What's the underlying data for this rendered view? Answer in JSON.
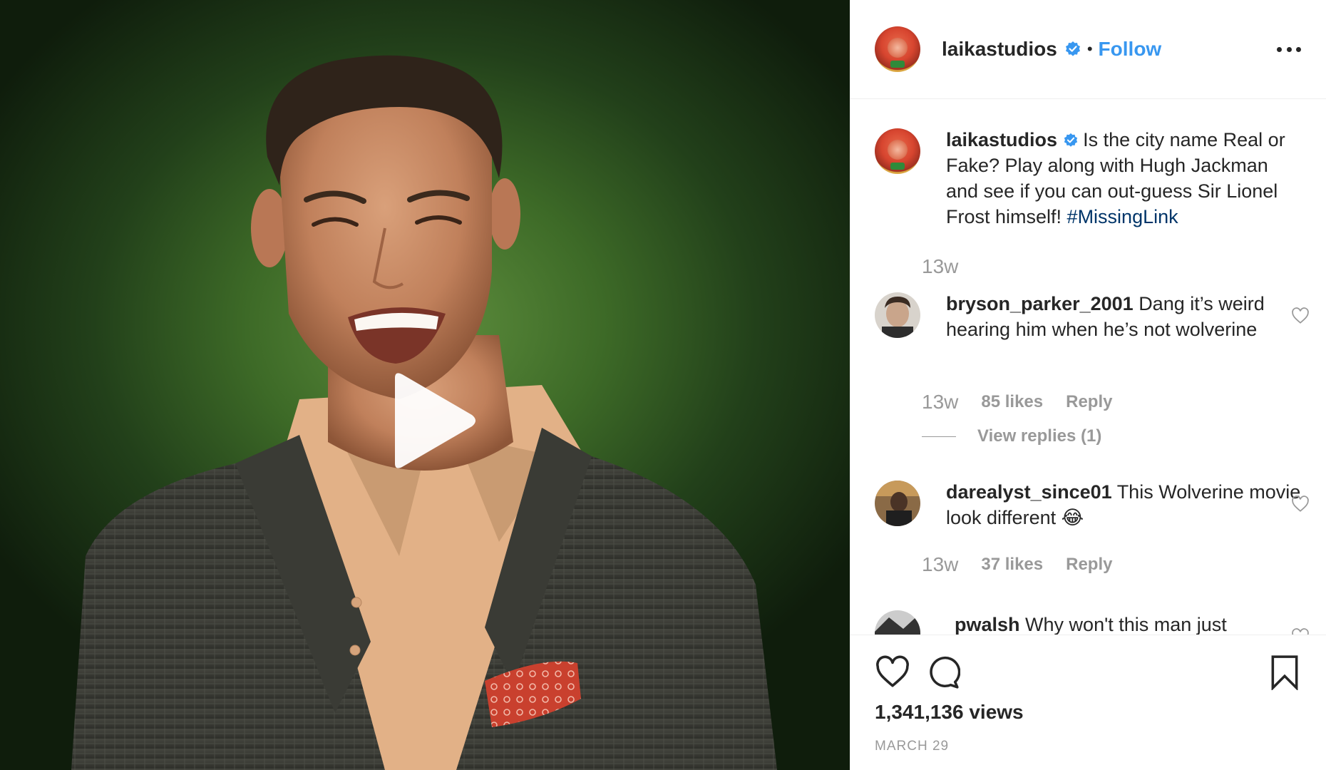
{
  "post": {
    "author": "laikastudios",
    "follow_label": "Follow",
    "separator": "•"
  },
  "caption": {
    "username": "laikastudios",
    "text": "Is the city name Real or Fake? Play along with Hugh Jackman and see if you can out-guess Sir Lionel Frost himself!",
    "hashtag": "#MissingLink",
    "time": "13w"
  },
  "comments": [
    {
      "username": "bryson_parker_2001",
      "text": "Dang it’s weird hearing him when he’s not wolverine",
      "time": "13w",
      "likes": "85 likes",
      "reply_label": "Reply",
      "view_replies": "View replies (1)"
    },
    {
      "username": "darealyst_since01",
      "text": "This Wolverine movie look different 😂",
      "time": "13w",
      "likes": "37 likes",
      "reply_label": "Reply"
    },
    {
      "username": "pwalsh",
      "text": "Why won't this man just"
    }
  ],
  "footer": {
    "views": "1,341,136 views",
    "date": "MARCH 29"
  },
  "icons": {
    "like": "heart-icon",
    "comment": "comment-icon",
    "save": "bookmark-icon",
    "more": "more-options-icon",
    "verified": "verified-badge-icon",
    "play": "play-icon"
  },
  "colors": {
    "link": "#3897f0",
    "hashtag": "#003569",
    "muted": "#999999",
    "text": "#262626",
    "verified": "#3897f0"
  }
}
